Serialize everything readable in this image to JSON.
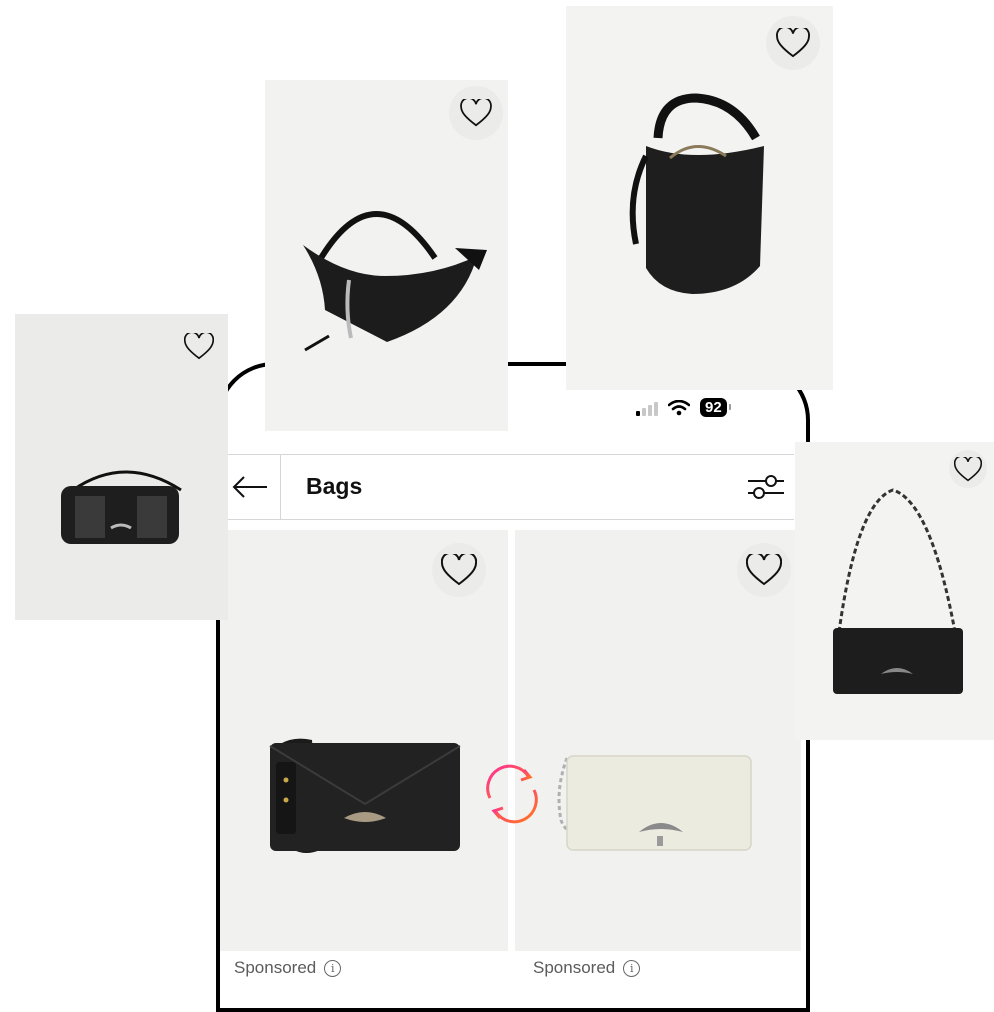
{
  "status_bar": {
    "battery": "92"
  },
  "header": {
    "title": "Bags",
    "back_icon": "arrow-left-icon",
    "filter_icon": "sliders-icon"
  },
  "products": [
    {
      "id": "studded-crossbody",
      "sponsored": ""
    },
    {
      "id": "crystal-hobo",
      "sponsored": ""
    },
    {
      "id": "leather-bucket",
      "sponsored": ""
    },
    {
      "id": "black-wings-clutch",
      "sponsored": "Sponsored"
    },
    {
      "id": "cream-chain-clutch",
      "sponsored": "Sponsored"
    },
    {
      "id": "black-shoulder-clutch",
      "sponsored": ""
    }
  ],
  "labels": {
    "sponsored": "Sponsored",
    "info_glyph": "i"
  },
  "colors": {
    "accent_gradient_start": "#ff2d9a",
    "accent_gradient_end": "#ff7a1a",
    "card_bg": "#f1f1f0"
  }
}
